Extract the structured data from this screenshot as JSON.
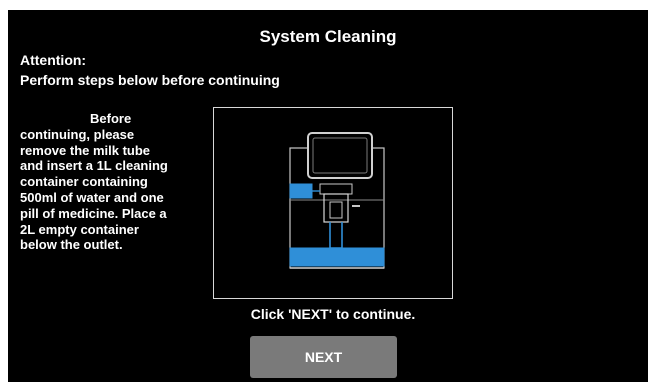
{
  "screen": {
    "title": "System Cleaning",
    "attention": "Attention:",
    "subtitle": "Perform steps below before continuing",
    "instructions": "Before continuing, please remove the milk tube and insert a 1L cleaning container containing 500ml of water and one pill of medicine. Place a 2L empty container below the outlet.",
    "hint": "Click 'NEXT' to continue.",
    "next_label": "NEXT"
  },
  "illustration": {
    "icon": "coffee-machine-icon",
    "highlight_color": "#2f8fd8",
    "outline_color": "#c8c8c8"
  }
}
